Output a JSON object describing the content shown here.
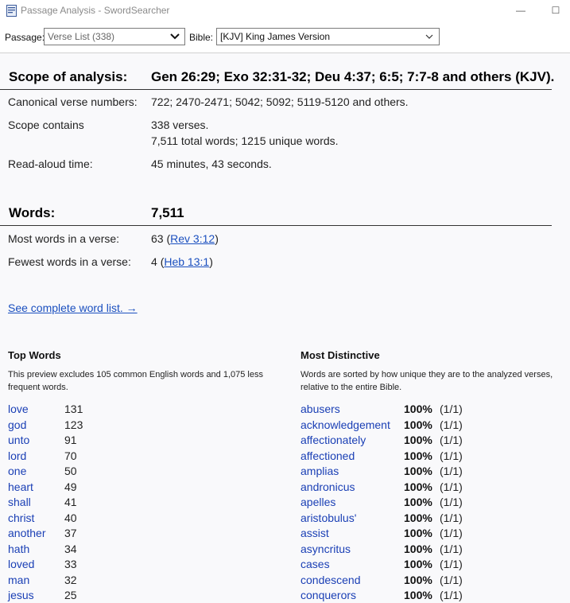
{
  "window": {
    "title": "Passage Analysis - SwordSearcher",
    "minimize_glyph": "—",
    "maximize_glyph": "☐"
  },
  "toolbar": {
    "passage_label": "Passage:",
    "passage_value": "Verse List (338)",
    "bible_label": "Bible:",
    "bible_value": "[KJV] King James Version"
  },
  "scope": {
    "heading": "Scope of analysis:",
    "passages": "Gen 26:29; Exo 32:31-32; Deu 4:37; 6:5; 7:7-8 and others (KJV).",
    "canonical_label": "Canonical verse numbers:",
    "canonical_value": "722; 2470-2471; 5042; 5092; 5119-5120 and others.",
    "contains_label": "Scope contains",
    "contains_line1": "338 verses.",
    "contains_line2": "7,511 total words; 1215 unique words.",
    "readaloud_label": "Read-aloud time:",
    "readaloud_value": "45 minutes, 43 seconds."
  },
  "words": {
    "heading": "Words:",
    "total": "7,511",
    "most_label": "Most words in a verse:",
    "most_count": "63",
    "most_ref": "Rev 3:12",
    "fewest_label": "Fewest words in a verse:",
    "fewest_count": "4",
    "fewest_ref": "Heb 13:1",
    "open_paren": "(",
    "close_paren": ")",
    "see_list": "See complete word list. →"
  },
  "top_words": {
    "title": "Top Words",
    "description": "This preview excludes 105 common English words and 1,075 less frequent words.",
    "items": [
      {
        "word": "love",
        "count": "131"
      },
      {
        "word": "god",
        "count": "123"
      },
      {
        "word": "unto",
        "count": "91"
      },
      {
        "word": "lord",
        "count": "70"
      },
      {
        "word": "one",
        "count": "50"
      },
      {
        "word": "heart",
        "count": "49"
      },
      {
        "word": "shall",
        "count": "41"
      },
      {
        "word": "christ",
        "count": "40"
      },
      {
        "word": "another",
        "count": "37"
      },
      {
        "word": "hath",
        "count": "34"
      },
      {
        "word": "loved",
        "count": "33"
      },
      {
        "word": "man",
        "count": "32"
      },
      {
        "word": "jesus",
        "count": "25"
      }
    ]
  },
  "distinctive": {
    "title": "Most Distinctive",
    "description": "Words are sorted by how unique they are to the analyzed verses, relative to the entire Bible.",
    "items": [
      {
        "word": "abusers",
        "pct": "100%",
        "ratio": "(1/1)"
      },
      {
        "word": "acknowledgement",
        "pct": "100%",
        "ratio": "(1/1)"
      },
      {
        "word": "affectionately",
        "pct": "100%",
        "ratio": "(1/1)"
      },
      {
        "word": "affectioned",
        "pct": "100%",
        "ratio": "(1/1)"
      },
      {
        "word": "amplias",
        "pct": "100%",
        "ratio": "(1/1)"
      },
      {
        "word": "andronicus",
        "pct": "100%",
        "ratio": "(1/1)"
      },
      {
        "word": "apelles",
        "pct": "100%",
        "ratio": "(1/1)"
      },
      {
        "word": "aristobulus'",
        "pct": "100%",
        "ratio": "(1/1)"
      },
      {
        "word": "assist",
        "pct": "100%",
        "ratio": "(1/1)"
      },
      {
        "word": "asyncritus",
        "pct": "100%",
        "ratio": "(1/1)"
      },
      {
        "word": "cases",
        "pct": "100%",
        "ratio": "(1/1)"
      },
      {
        "word": "condescend",
        "pct": "100%",
        "ratio": "(1/1)"
      },
      {
        "word": "conquerors",
        "pct": "100%",
        "ratio": "(1/1)"
      }
    ]
  }
}
